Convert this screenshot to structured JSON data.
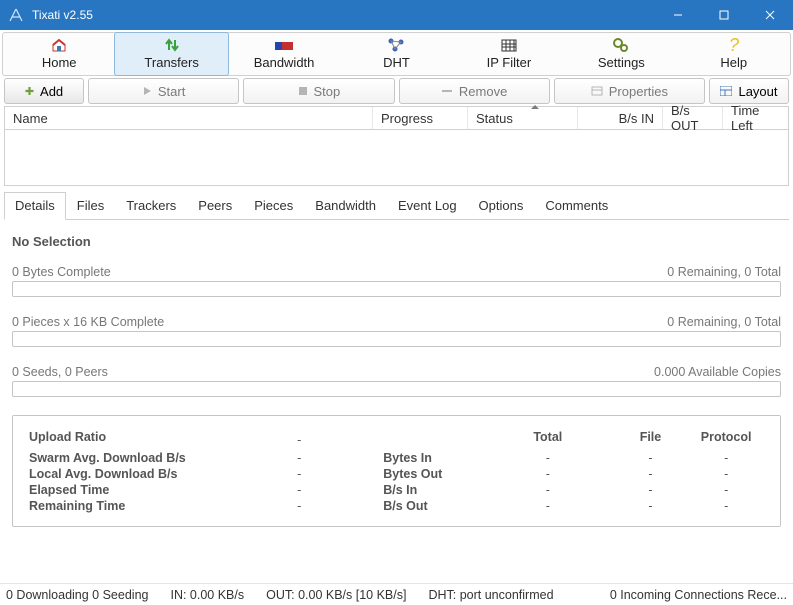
{
  "window": {
    "title": "Tixati v2.55"
  },
  "tabs": {
    "home": "Home",
    "transfers": "Transfers",
    "bandwidth": "Bandwidth",
    "dht": "DHT",
    "ipfilter": "IP Filter",
    "settings": "Settings",
    "help": "Help"
  },
  "actions": {
    "add": "Add",
    "start": "Start",
    "stop": "Stop",
    "remove": "Remove",
    "properties": "Properties",
    "layout": "Layout"
  },
  "columns": {
    "name": "Name",
    "progress": "Progress",
    "status": "Status",
    "bps_in": "B/s IN",
    "bps_out": "B/s OUT",
    "time_left": "Time Left"
  },
  "detailTabs": {
    "details": "Details",
    "files": "Files",
    "trackers": "Trackers",
    "peers": "Peers",
    "pieces": "Pieces",
    "bandwidth": "Bandwidth",
    "eventlog": "Event Log",
    "options": "Options",
    "comments": "Comments"
  },
  "details": {
    "no_selection": "No Selection",
    "bytes_left": "0 Bytes Complete",
    "bytes_right": "0 Remaining,  0 Total",
    "pieces_left": "0 Pieces  x  16 KB Complete",
    "pieces_right": "0 Remaining,  0 Total",
    "seeds_left": "0 Seeds, 0 Peers",
    "seeds_right": "0.000 Available Copies"
  },
  "metrics": {
    "hdr_total": "Total",
    "hdr_file": "File",
    "hdr_protocol": "Protocol",
    "upload_ratio": "Upload Ratio",
    "swarm_dl": "Swarm Avg. Download B/s",
    "local_dl": "Local Avg. Download B/s",
    "elapsed": "Elapsed Time",
    "remaining": "Remaining Time",
    "bytes_in": "Bytes In",
    "bytes_out": "Bytes Out",
    "bps_in": "B/s In",
    "bps_out": "B/s Out",
    "dash": "-"
  },
  "status": {
    "dl": "0 Downloading  0 Seeding",
    "in": "IN: 0.00 KB/s",
    "out": "OUT: 0.00 KB/s [10 KB/s]",
    "dht": "DHT: port unconfirmed",
    "incoming": "0 Incoming Connections Rece..."
  }
}
